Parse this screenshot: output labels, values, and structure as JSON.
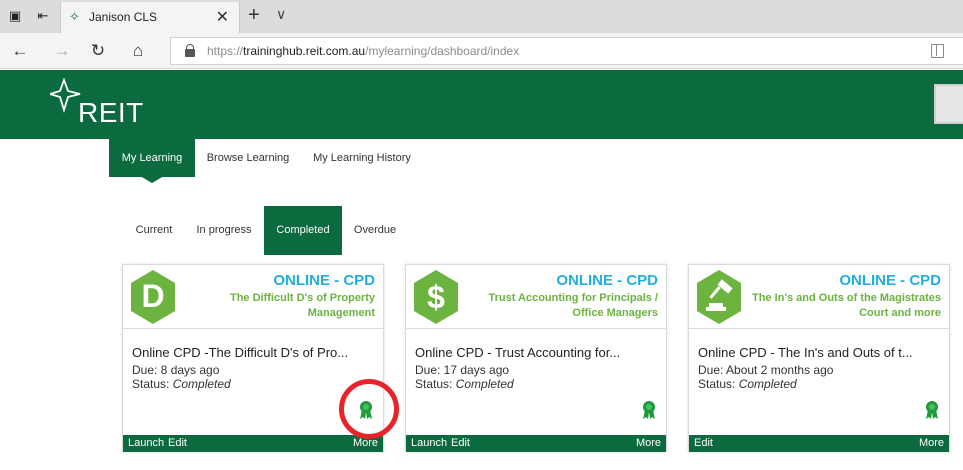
{
  "browser": {
    "tab_title": "Janison CLS",
    "url_prefix": "https://",
    "url_host": "traininghub.reit.com.au",
    "url_path": "/mylearning/dashboard/index",
    "icons": [
      "tab-actions-icon",
      "set-aside-icon",
      "back-icon",
      "forward-icon",
      "refresh-icon",
      "home-icon",
      "lock-icon",
      "reading-view-icon",
      "favorites-icon",
      "new-tab-icon",
      "tab-dropdown-icon",
      "close-icon"
    ]
  },
  "header": {
    "logo_text": "REIT",
    "brand_color": "#0b6a3e"
  },
  "main_nav": [
    {
      "label": "My Learning",
      "active": true
    },
    {
      "label": "Browse Learning",
      "active": false
    },
    {
      "label": "My Learning History",
      "active": false
    }
  ],
  "sub_tabs": [
    {
      "label": "Current",
      "active": false
    },
    {
      "label": "In progress",
      "active": false
    },
    {
      "label": "Completed",
      "active": true
    },
    {
      "label": "Overdue",
      "active": false
    }
  ],
  "cards": [
    {
      "icon": "letter-d-icon",
      "icon_glyph": "D",
      "category": "ONLINE - CPD",
      "subtitle": "The Difficult D's of Property Management",
      "title": "Online CPD -The Difficult D's of Pro...",
      "due": "Due: 8 days ago",
      "status_label": "Status:",
      "status_value": "Completed",
      "footer_links": [
        "Launch",
        "Edit"
      ],
      "more": "More"
    },
    {
      "icon": "dollar-icon",
      "icon_glyph": "$",
      "category": "ONLINE - CPD",
      "subtitle": "Trust Accounting for Principals / Office Managers",
      "title": "Online CPD - Trust Accounting for...",
      "due": "Due: 17 days ago",
      "status_label": "Status:",
      "status_value": "Completed",
      "footer_links": [
        "Launch",
        "Edit"
      ],
      "more": "More"
    },
    {
      "icon": "gavel-icon",
      "icon_glyph": "",
      "category": "ONLINE - CPD",
      "subtitle": "The In's and Outs of the Magistrates Court and more",
      "title": "Online CPD - The In's and Outs of t...",
      "due": "Due: About 2 months ago",
      "status_label": "Status:",
      "status_value": "Completed",
      "footer_links": [
        "Edit"
      ],
      "more": "More"
    }
  ],
  "colors": {
    "hex_green": "#6cb33f",
    "category_blue": "#23aee2",
    "award_green": "#1e9a3a",
    "highlight_red": "#e8232a"
  }
}
